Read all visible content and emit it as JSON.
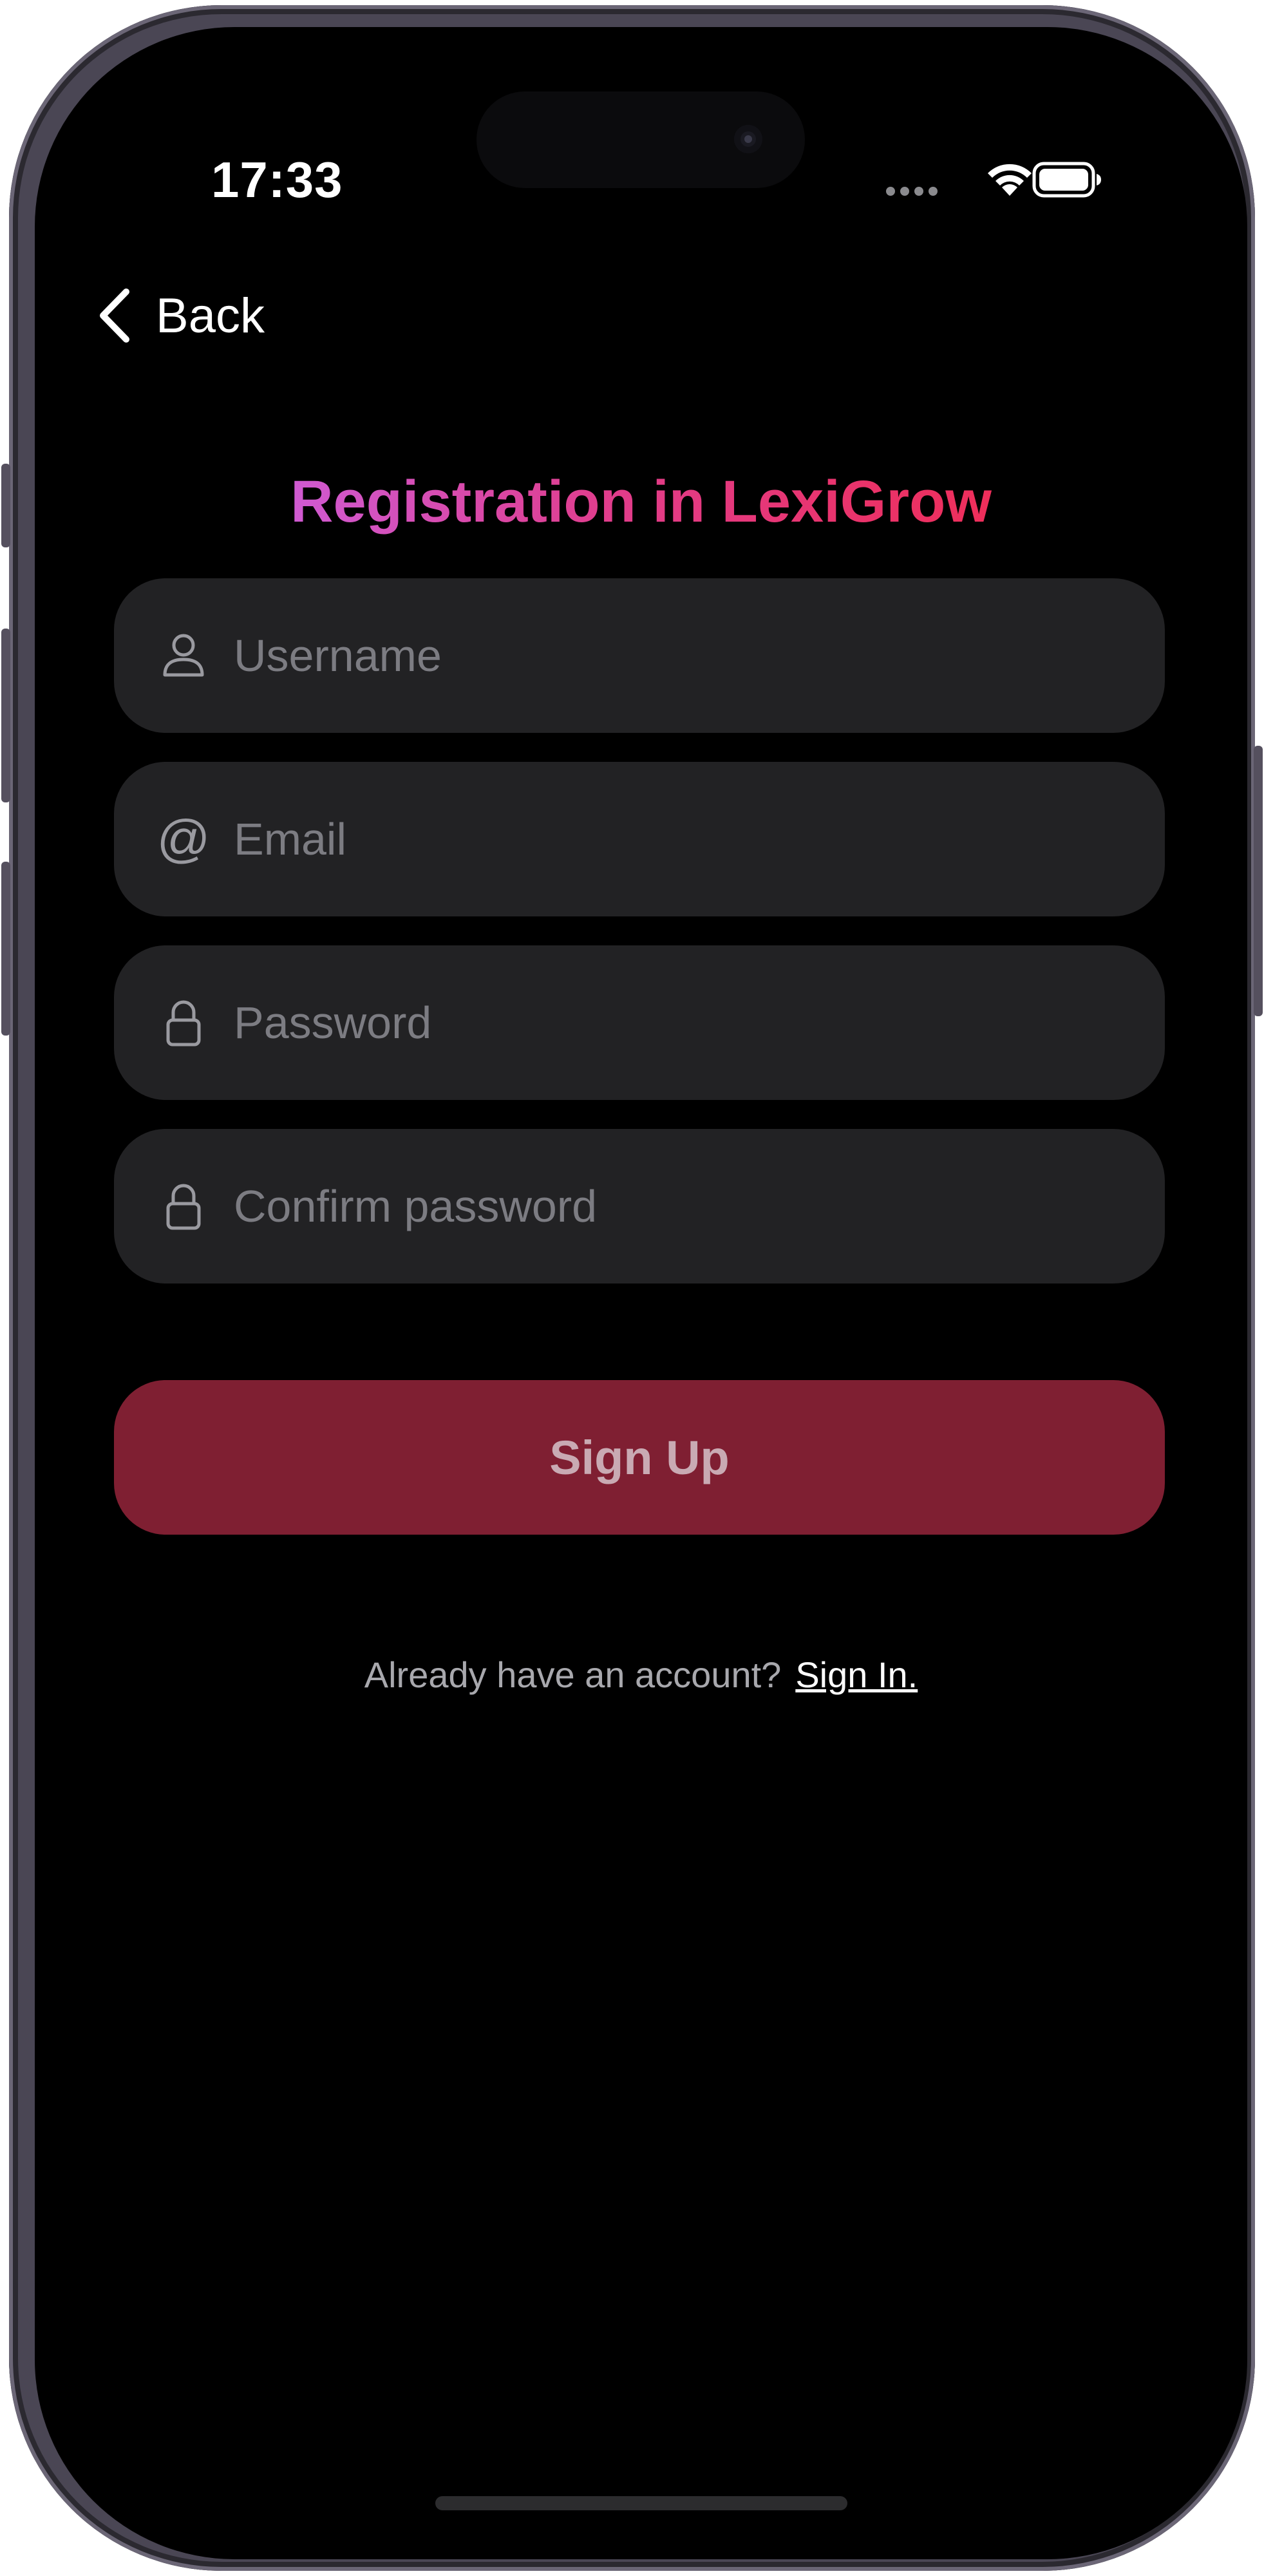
{
  "status_bar": {
    "time": "17:33",
    "icons": [
      "signal-dots-icon",
      "wifi-icon",
      "battery-icon"
    ]
  },
  "nav": {
    "back_label": "Back",
    "back_icon": "chevron-left-icon"
  },
  "title": "Registration in LexiGrow",
  "form": {
    "fields": [
      {
        "icon": "person-icon",
        "placeholder": "Username",
        "value": ""
      },
      {
        "icon": "at-sign-icon",
        "placeholder": "Email",
        "value": ""
      },
      {
        "icon": "lock-icon",
        "placeholder": "Password",
        "value": ""
      },
      {
        "icon": "lock-icon",
        "placeholder": "Confirm password",
        "value": ""
      }
    ],
    "submit_label": "Sign Up"
  },
  "footer": {
    "prompt": "Already have an account?",
    "link_label": "Sign In."
  },
  "colors": {
    "background": "#000000",
    "field_background": "#222224",
    "button_background": "#7f1f32",
    "title_gradient_start": "#cf5ad2",
    "title_gradient_end": "#ee2e5a",
    "placeholder": "#7c7c82"
  }
}
